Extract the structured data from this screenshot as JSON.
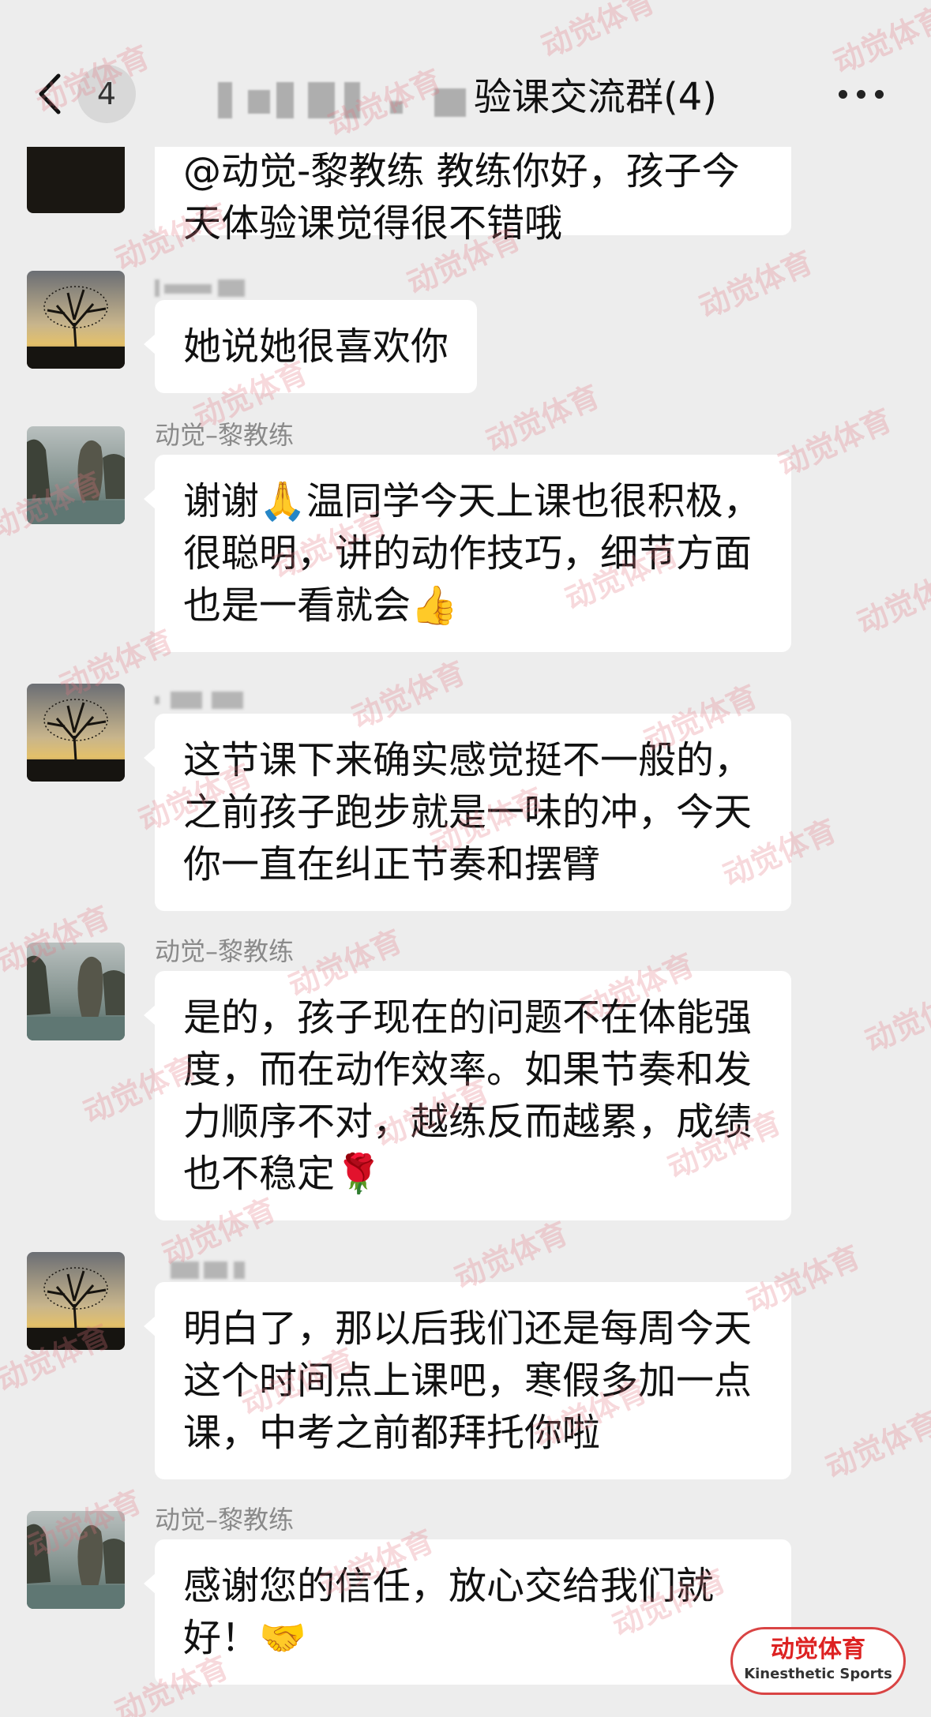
{
  "header": {
    "unread_count": "4",
    "title": "验课交流群(4)"
  },
  "messages": [
    {
      "sender": "",
      "text": "@动觉-黎教练 教练你好，孩子今天体验课觉得很不错哦"
    },
    {
      "sender": "",
      "text": "她说她很喜欢你"
    },
    {
      "sender": "动觉–黎教练",
      "text": "谢谢🙏温同学今天上课也很积极，很聪明，讲的动作技巧，细节方面也是一看就会👍"
    },
    {
      "sender": "",
      "text": "这节课下来确实感觉挺不一般的，之前孩子跑步就是一味的冲，今天你一直在纠正节奏和摆臂"
    },
    {
      "sender": "动觉–黎教练",
      "text": "是的，孩子现在的问题不在体能强度，而在动作效率。如果节奏和发力顺序不对，越练反而越累，成绩也不稳定🌹"
    },
    {
      "sender": "",
      "text": "明白了，那以后我们还是每周今天这个时间点上课吧，寒假多加一点课，中考之前都拜托你啦"
    },
    {
      "sender": "动觉–黎教练",
      "text": "感谢您的信任，放心交给我们就好！🤝"
    }
  ],
  "icons": {
    "back": "chevron-left-icon",
    "more": "more-dots-icon",
    "tree_avatar": "tree-sunset-avatar",
    "rock_avatar": "sea-rock-avatar"
  },
  "watermark": "动觉体育",
  "logo": {
    "cn": "动觉体育",
    "en": "Kinesthetic Sports"
  },
  "colors": {
    "background": "#ededed",
    "bubble": "#ffffff",
    "watermark": "#e27882",
    "logo_red": "#d22222"
  }
}
